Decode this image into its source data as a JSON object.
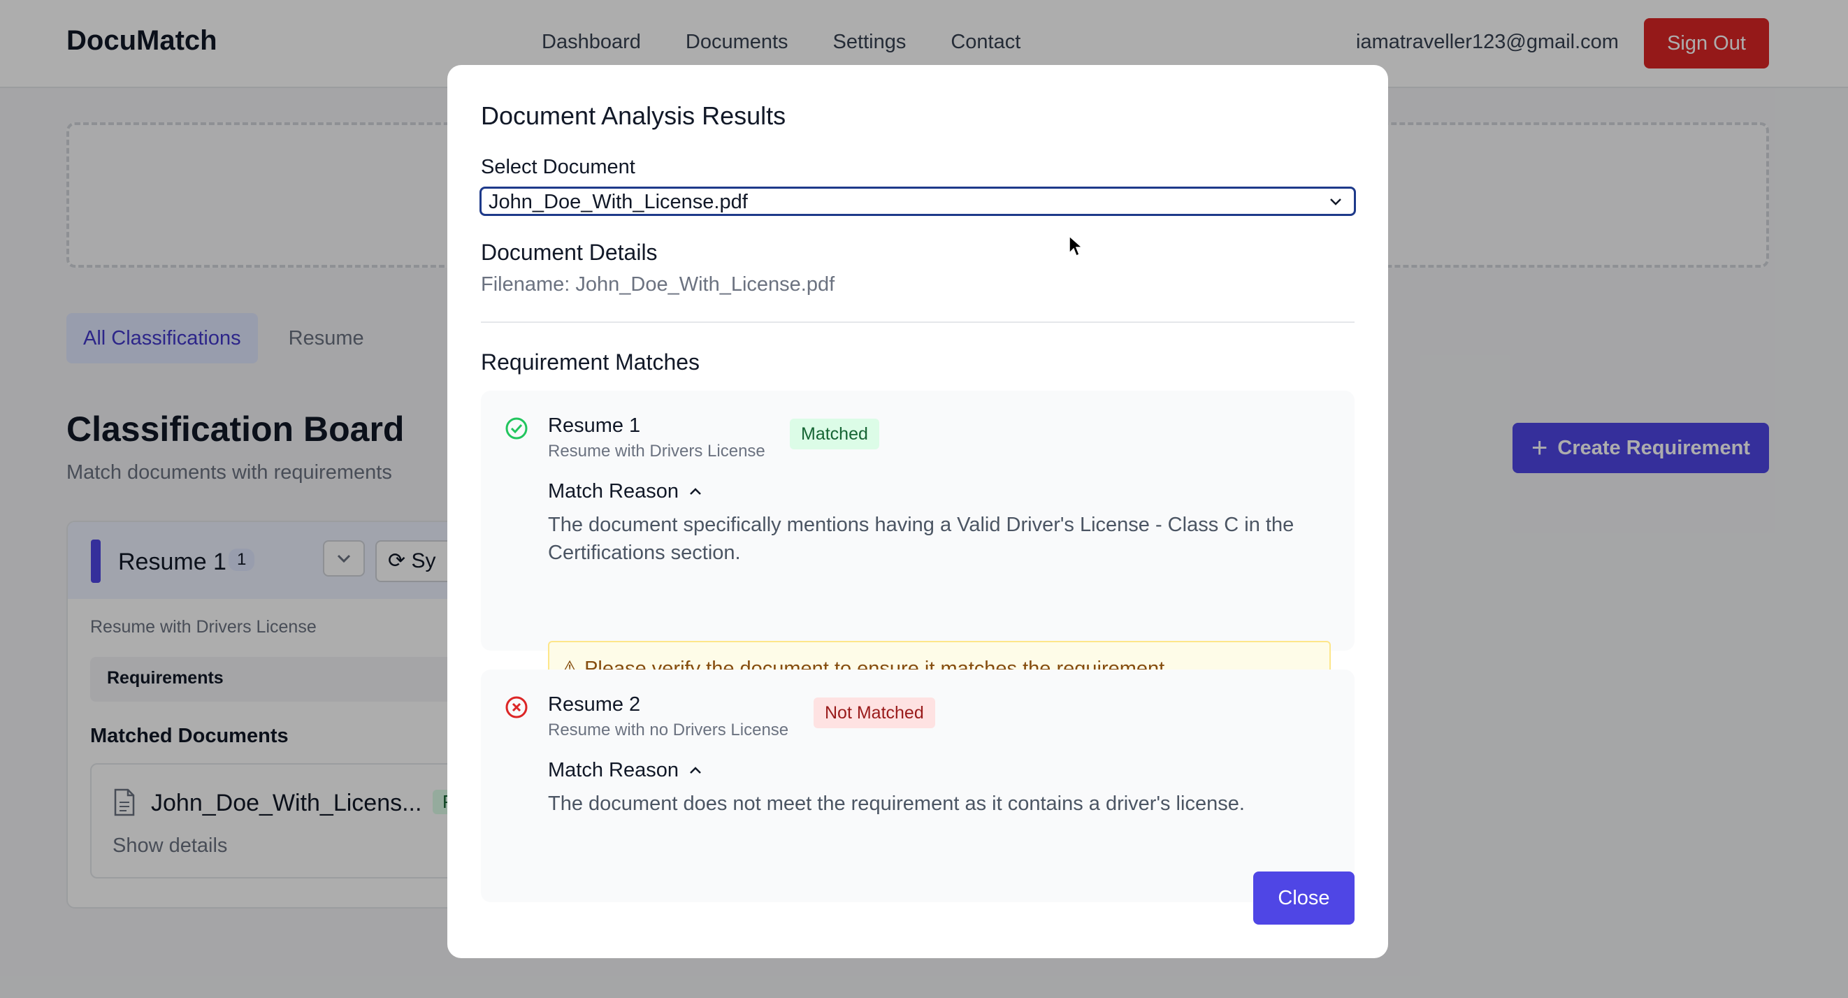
{
  "app": {
    "brand": "DocuMatch",
    "nav": [
      "Dashboard",
      "Documents",
      "Settings",
      "Contact"
    ],
    "user_email": "iamatraveller123@gmail.com",
    "sign_out_label": "Sign Out"
  },
  "tabs": [
    "All Classifications",
    "Resume"
  ],
  "board": {
    "title": "Classification Board",
    "subtitle": "Match documents with requirements",
    "create_label": "Create Requirement"
  },
  "card": {
    "title": "Resume 1",
    "count": "1",
    "sync_label": "Sy",
    "description": "Resume with Drivers License",
    "requirements_label": "Requirements",
    "matched_heading": "Matched Documents",
    "doc_name": "John_Doe_With_Licens...",
    "doc_badge": "P",
    "show_details": "Show details"
  },
  "modal": {
    "title": "Document Analysis Results",
    "select_label": "Select Document",
    "selected_document": "John_Doe_With_License.pdf",
    "details_heading": "Document Details",
    "filename": "Filename: John_Doe_With_License.pdf",
    "matches_heading": "Requirement Matches",
    "matches": [
      {
        "title": "Resume 1",
        "subtitle": "Resume with Drivers License",
        "status": "Matched",
        "reason_label": "Match Reason",
        "reason": "The document specifically mentions having a Valid Driver's License - Class C in the Certifications section.",
        "warning": "Please verify the document to ensure it matches the requirement."
      },
      {
        "title": "Resume 2",
        "subtitle": "Resume with no Drivers License",
        "status": "Not Matched",
        "reason_label": "Match Reason",
        "reason": "The document does not meet the requirement as it contains a driver's license."
      }
    ],
    "close_label": "Close"
  },
  "colors": {
    "accent": "#4f46e5",
    "danger": "#dc2626",
    "success_bg": "#dcfce7",
    "error_bg": "#fee2e2",
    "warning_bg": "#fefce8"
  }
}
